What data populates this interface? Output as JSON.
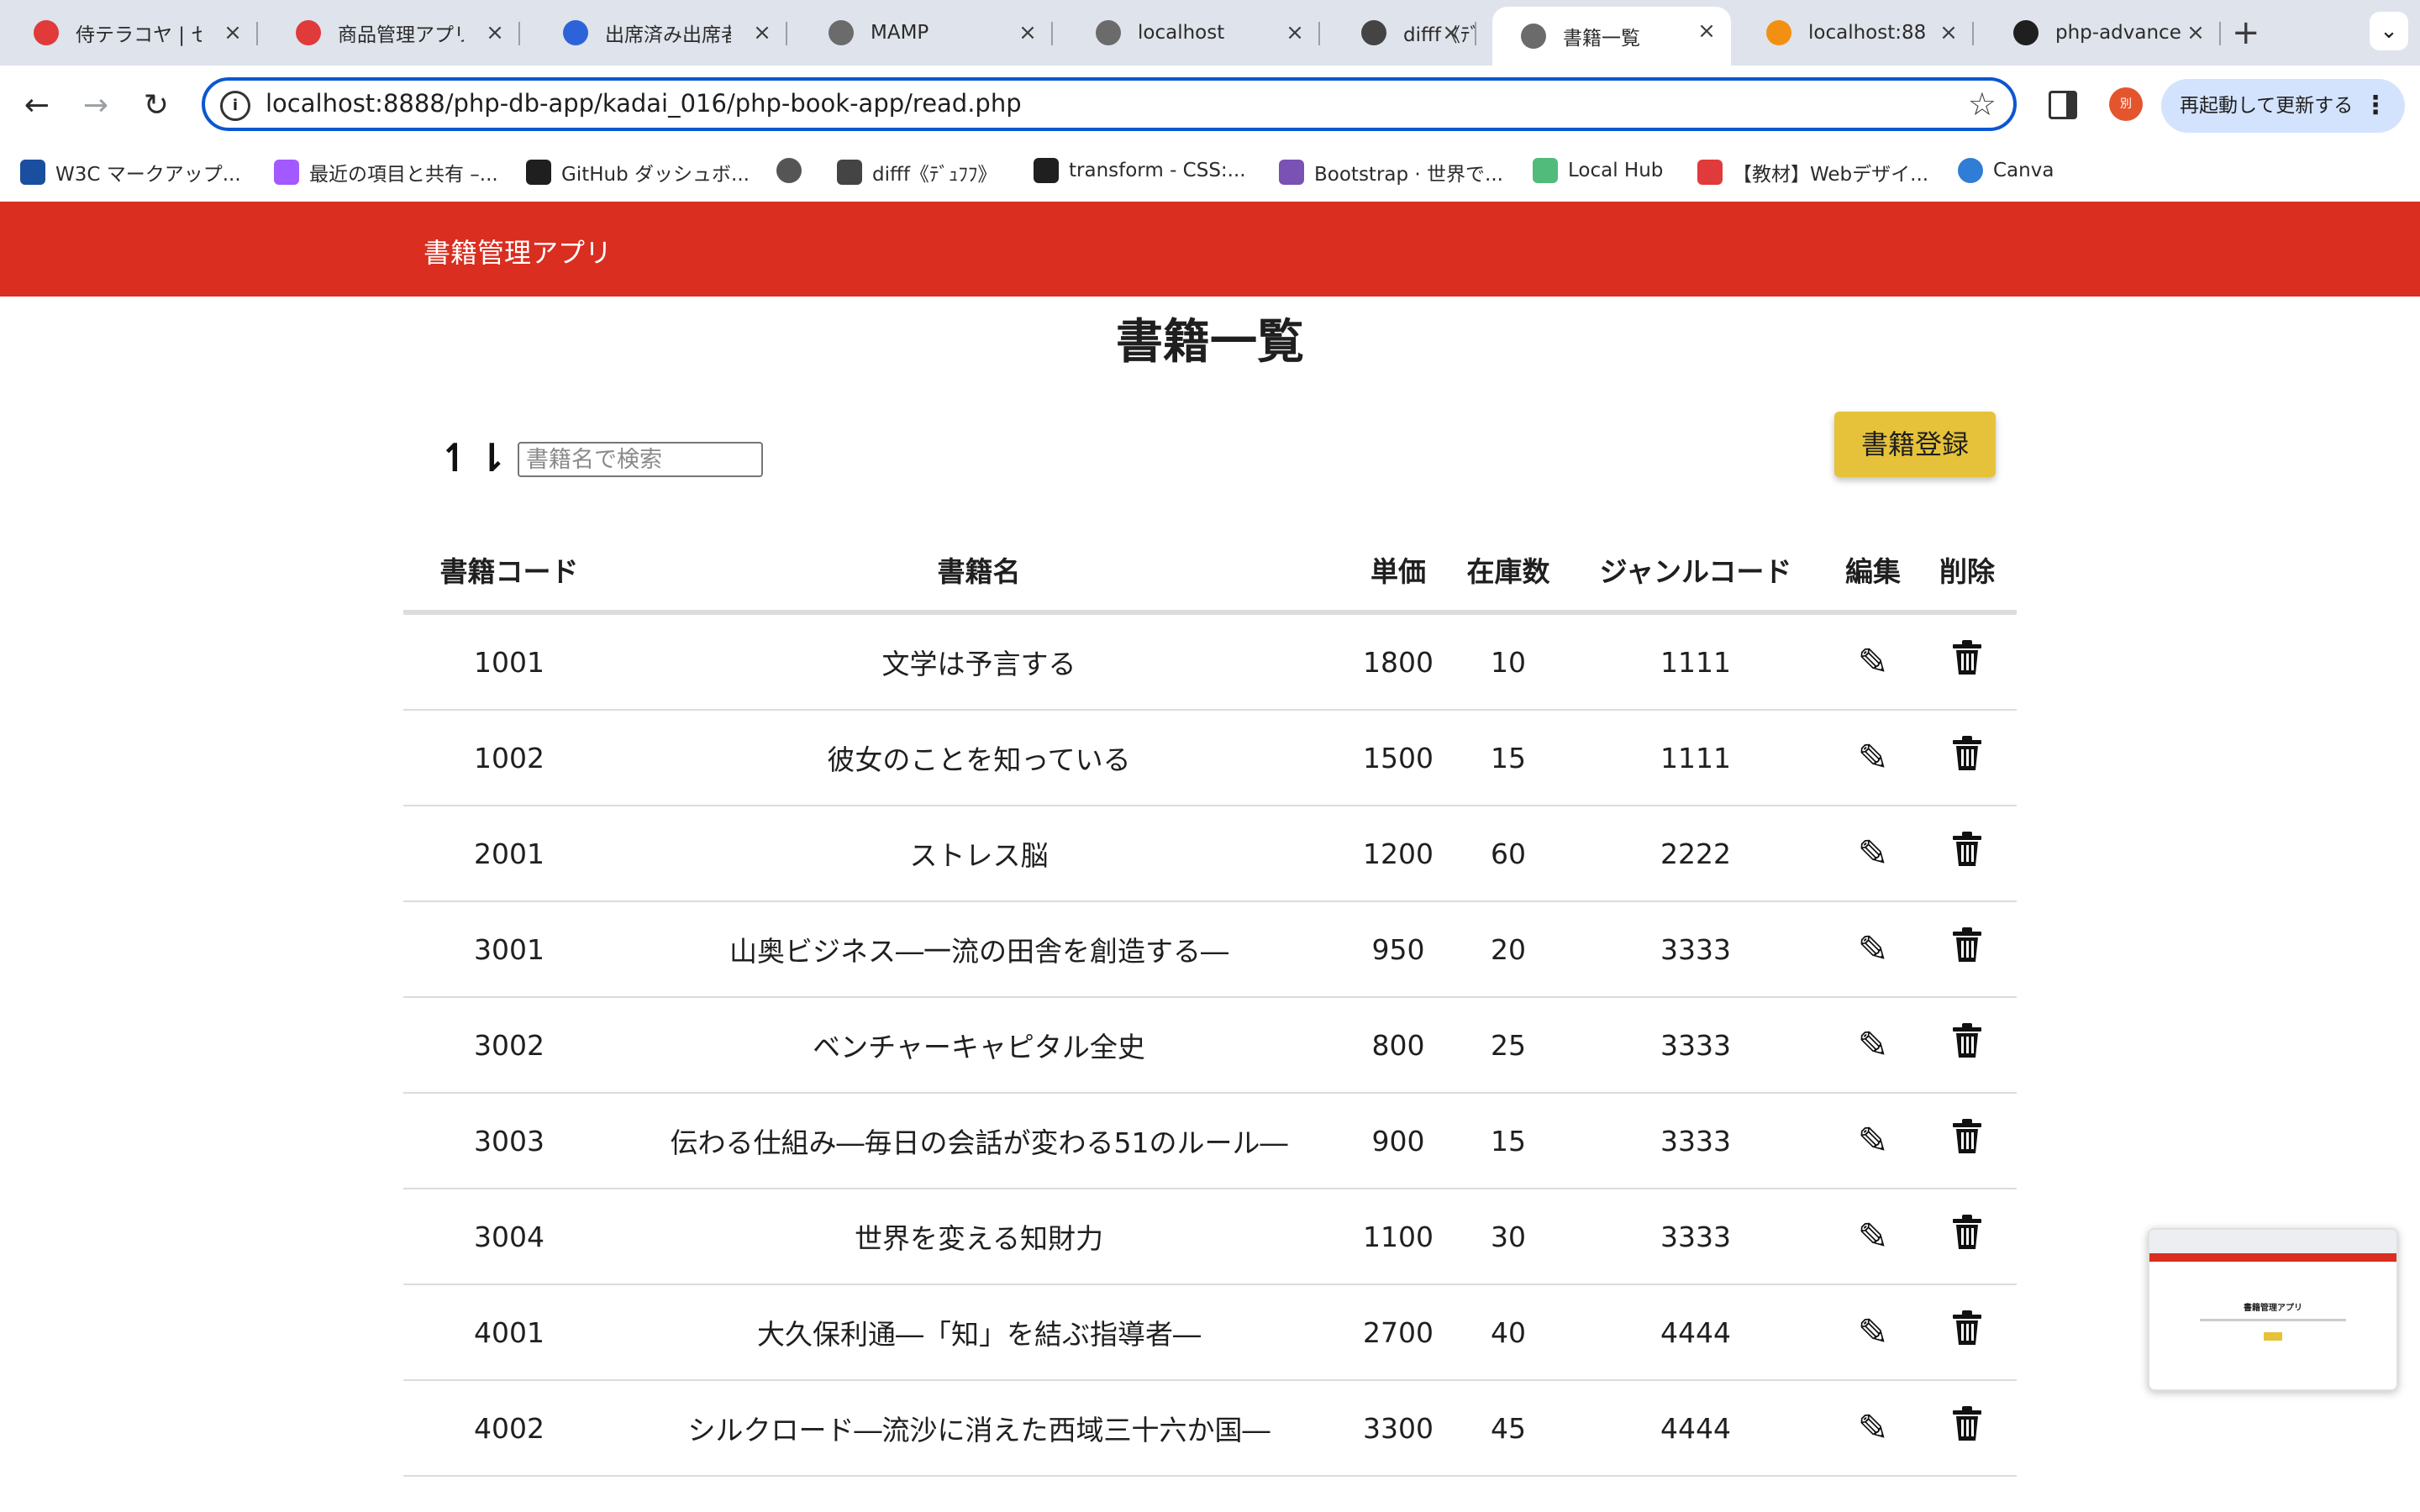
{
  "browser": {
    "tabs": [
      {
        "title": "侍テラコヤ | セ",
        "favicon": "samurai-icon",
        "active": false
      },
      {
        "title": "商品管理アプリ",
        "favicon": "samurai-icon",
        "active": false
      },
      {
        "title": "出席済み出席者",
        "favicon": "zoom-icon",
        "active": false
      },
      {
        "title": "MAMP",
        "favicon": "globe-icon",
        "active": false
      },
      {
        "title": "localhost",
        "favicon": "globe-icon",
        "active": false
      },
      {
        "title": "difff《ﾃﾞｭﾌﾌ》",
        "favicon": "difff-icon",
        "active": false
      },
      {
        "title": "書籍一覧",
        "favicon": "globe-icon",
        "active": true
      },
      {
        "title": "localhost:88",
        "favicon": "phpmyadmin-icon",
        "active": false
      },
      {
        "title": "php-advance",
        "favicon": "github-icon",
        "active": false
      }
    ],
    "address": "localhost:8888/php-db-app/kadai_016/php-book-app/read.php",
    "relaunch_label": "再起動して更新する",
    "profile_initial": "別",
    "bookmarks": [
      {
        "label": "W3C マークアップ...",
        "icon": "w3c-icon"
      },
      {
        "label": "最近の項目と共有 –...",
        "icon": "figma-icon"
      },
      {
        "label": "GitHub ダッシュボ...",
        "icon": "github-icon"
      },
      {
        "label": "",
        "icon": "globe-icon"
      },
      {
        "label": "difff《ﾃﾞｭﾌﾌ》",
        "icon": "difff-icon"
      },
      {
        "label": "transform - CSS:...",
        "icon": "mdn-icon"
      },
      {
        "label": "Bootstrap · 世界で...",
        "icon": "bootstrap-icon"
      },
      {
        "label": "Local Hub",
        "icon": "localhub-icon"
      },
      {
        "label": "【教材】Webデザイ...",
        "icon": "samurai-icon"
      },
      {
        "label": "Canva",
        "icon": "canva-icon"
      }
    ]
  },
  "app": {
    "brand": "書籍管理アプリ",
    "page_title": "書籍一覧",
    "sort_asc_symbol": "↿",
    "sort_desc_symbol": "⇂",
    "search_placeholder": "書籍名で検索",
    "register_label": "書籍登録",
    "columns": [
      "書籍コード",
      "書籍名",
      "単価",
      "在庫数",
      "ジャンルコード",
      "編集",
      "削除"
    ],
    "rows": [
      {
        "code": "1001",
        "name": "文学は予言する",
        "price": "1800",
        "stock": "10",
        "genre": "1111"
      },
      {
        "code": "1002",
        "name": "彼女のことを知っている",
        "price": "1500",
        "stock": "15",
        "genre": "1111"
      },
      {
        "code": "2001",
        "name": "ストレス脳",
        "price": "1200",
        "stock": "60",
        "genre": "2222"
      },
      {
        "code": "3001",
        "name": "山奥ビジネス―一流の田舎を創造する―",
        "price": "950",
        "stock": "20",
        "genre": "3333"
      },
      {
        "code": "3002",
        "name": "ベンチャーキャピタル全史",
        "price": "800",
        "stock": "25",
        "genre": "3333"
      },
      {
        "code": "3003",
        "name": "伝わる仕組み―毎日の会話が変わる51のルール―",
        "price": "900",
        "stock": "15",
        "genre": "3333"
      },
      {
        "code": "3004",
        "name": "世界を変える知財力",
        "price": "1100",
        "stock": "30",
        "genre": "3333"
      },
      {
        "code": "4001",
        "name": "大久保利通―「知」を結ぶ指導者―",
        "price": "2700",
        "stock": "40",
        "genre": "4444"
      },
      {
        "code": "4002",
        "name": "シルクロード―流沙に消えた西域三十六か国―",
        "price": "3300",
        "stock": "45",
        "genre": "4444"
      }
    ],
    "edit_icon": "pencil-icon",
    "delete_icon": "trash-icon",
    "thumbnail_title": "書籍管理アプリ"
  },
  "colors": {
    "appbar": "#d92e20",
    "register_button": "#e6c23a",
    "omnibox_border": "#0b57d0"
  }
}
